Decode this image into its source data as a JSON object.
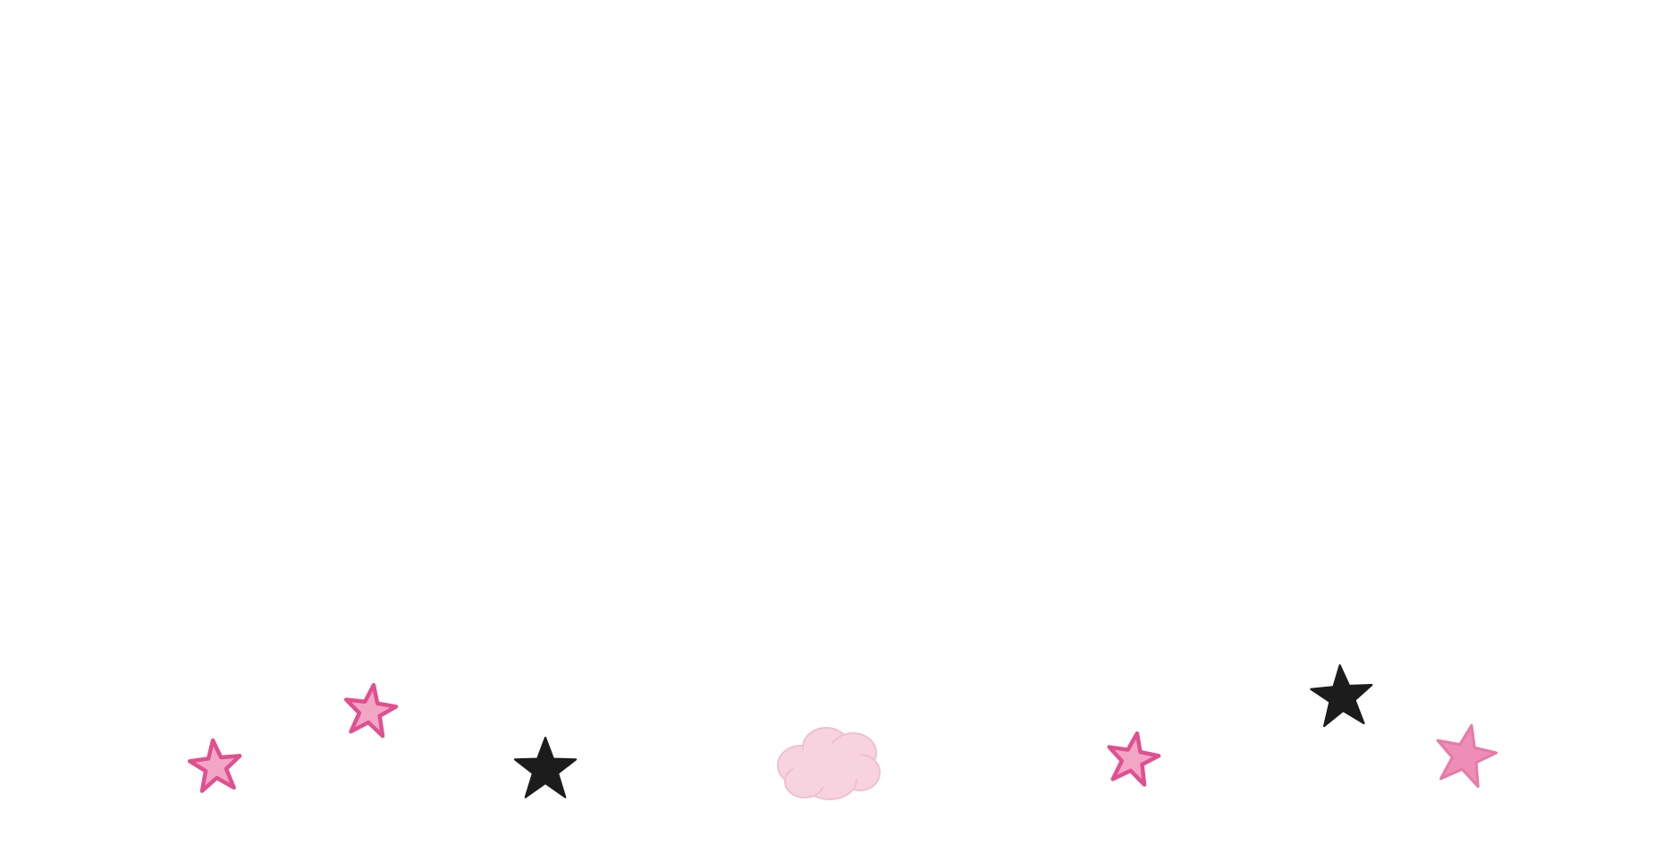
{
  "scene": {
    "background_color": "#ffffff",
    "decorations": [
      {
        "kind": "star",
        "style": "pink-outline",
        "icon": "pink-star-icon"
      },
      {
        "kind": "star",
        "style": "pink-outline",
        "icon": "pink-star-icon"
      },
      {
        "kind": "star",
        "style": "black-filled",
        "icon": "black-star-icon"
      },
      {
        "kind": "cloud",
        "style": "pale-pink",
        "icon": "pink-cloud-icon"
      },
      {
        "kind": "star",
        "style": "pink-outline",
        "icon": "pink-star-icon"
      },
      {
        "kind": "star",
        "style": "black-filled",
        "icon": "black-star-icon"
      },
      {
        "kind": "star",
        "style": "pink-filled",
        "icon": "pink-star-icon"
      }
    ],
    "colors": {
      "pink_outline": "#e0508f",
      "pink_fill": "#f2a6c6",
      "pink_star_solid": "#ee8db6",
      "black_star": "#1c1c1c",
      "cloud_fill": "#f7d3e0",
      "cloud_edge": "#f1bfd2"
    }
  }
}
